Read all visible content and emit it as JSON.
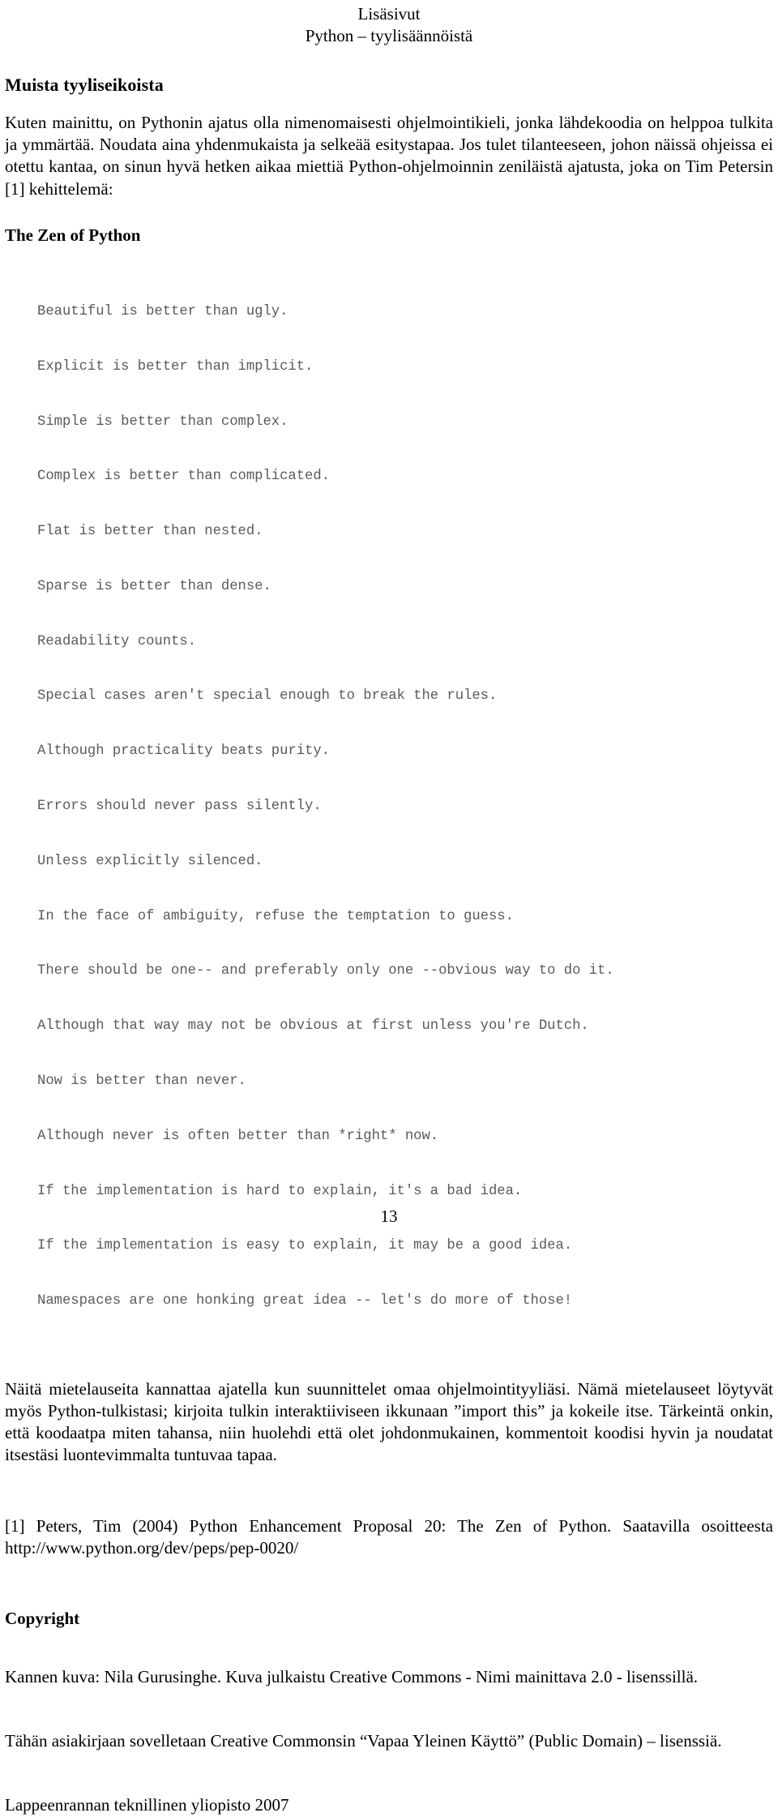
{
  "header": {
    "line1": "Lisäsivut",
    "line2": "Python – tyylisäännöistä"
  },
  "sections": {
    "main_heading": "Muista tyyliseikoista",
    "intro_paragraph": "Kuten mainittu, on Pythonin ajatus olla nimenomaisesti ohjelmointikieli, jonka lähdekoodia on helppoa tulkita ja ymmärtää. Noudata aina yhdenmukaista ja selkeää esitystapaa. Jos tulet tilanteeseen, johon näissä ohjeissa ei otettu kantaa, on sinun hyvä hetken aikaa miettiä Python-ohjelmoinnin zeniläistä ajatusta, joka on Tim Petersin [1] kehittelemä:",
    "zen_heading": "The Zen of Python",
    "zen_lines": [
      "Beautiful is better than ugly.",
      "Explicit is better than implicit.",
      "Simple is better than complex.",
      "Complex is better than complicated.",
      "Flat is better than nested.",
      "Sparse is better than dense.",
      "Readability counts.",
      "Special cases aren't special enough to break the rules.",
      "Although practicality beats purity.",
      "Errors should never pass silently.",
      "Unless explicitly silenced.",
      "In the face of ambiguity, refuse the temptation to guess.",
      "There should be one-- and preferably only one --obvious way to do it.",
      "Although that way may not be obvious at first unless you're Dutch.",
      "Now is better than never.",
      "Although never is often better than *right* now.",
      "If the implementation is hard to explain, it's a bad idea.",
      "If the implementation is easy to explain, it may be a good idea.",
      "Namespaces are one honking great idea -- let's do more of those!"
    ],
    "after_zen_paragraph": "Näitä mietelauseita kannattaa ajatella kun suunnittelet omaa ohjelmointityyliäsi. Nämä mietelauseet löytyvät myös Python-tulkistasi; kirjoita tulkin interaktiiviseen ikkunaan ”import this” ja kokeile itse. Tärkeintä onkin, että koodaatpa miten tahansa, niin huolehdi että olet johdonmukainen, kommentoit koodisi hyvin ja noudatat itsestäsi luontevimmalta tuntuvaa tapaa.",
    "reference": "[1] Peters, Tim (2004) Python Enhancement Proposal 20: The Zen of Python. Saatavilla osoitteesta http://www.python.org/dev/peps/pep-0020/",
    "copyright_heading": "Copyright",
    "copyright_image": "Kannen kuva: Nila Gurusinghe. Kuva julkaistu Creative Commons - Nimi mainittava 2.0 - lisenssillä.",
    "copyright_license": "Tähän asiakirjaan sovelletaan Creative Commonsin “Vapaa Yleinen Käyttö” (Public Domain) – lisenssiä.",
    "publisher": "Lappeenrannan teknillinen yliopisto 2007"
  },
  "footer": {
    "page_number": "13"
  },
  "colors": {
    "text": "#000000",
    "code_text": "#5a5a5a",
    "background": "#ffffff"
  }
}
